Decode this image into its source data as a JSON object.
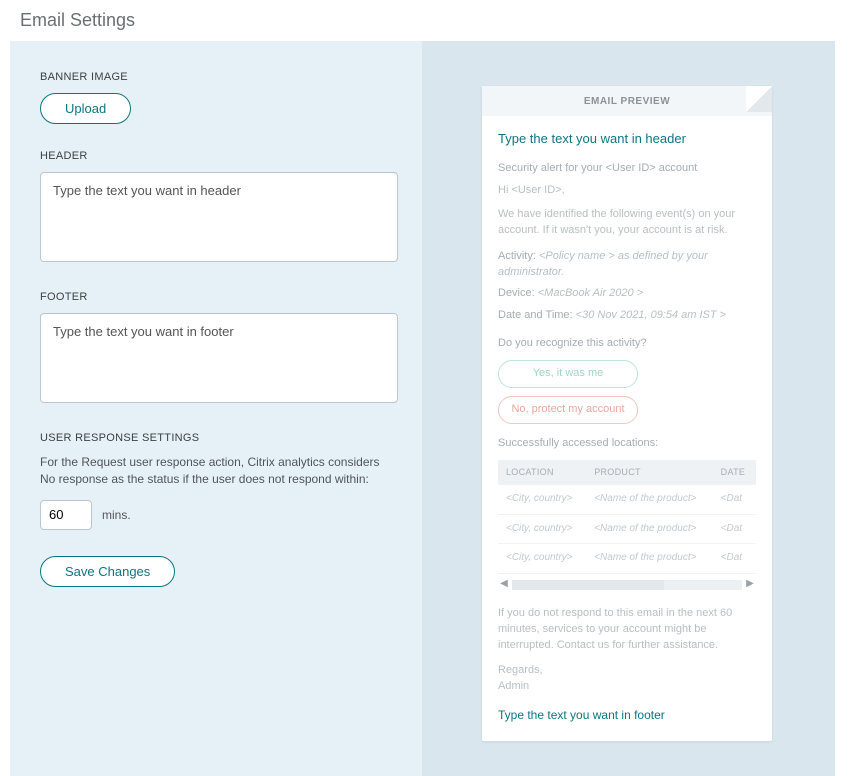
{
  "page": {
    "title": "Email Settings"
  },
  "banner": {
    "label": "BANNER IMAGE",
    "upload_label": "Upload"
  },
  "header": {
    "label": "HEADER",
    "placeholder": "Type the text you want in header"
  },
  "footer": {
    "label": "FOOTER",
    "placeholder": "Type the text you want in footer"
  },
  "response": {
    "label": "USER RESPONSE SETTINGS",
    "description": "For the Request user response action, Citrix analytics considers No response as the status if the user does not respond within:",
    "value": "60",
    "unit": "mins."
  },
  "save": {
    "label": "Save Changes"
  },
  "preview": {
    "title": "EMAIL PREVIEW",
    "header_text": "Type the text you want in header",
    "subject": "Security alert for your <User ID> account",
    "greeting": "Hi <User ID>,",
    "intro": "We have identified the following event(s) on your account. If it wasn't you, your account is at risk.",
    "activity_label": "Activity:",
    "activity_value": "<Policy name > as defined by your administrator.",
    "device_label": "Device:",
    "device_value": "<MacBook Air 2020 >",
    "datetime_label": "Date and Time:",
    "datetime_value": "<30 Nov 2021, 09:54 am IST >",
    "recognize": "Do you recognize this activity?",
    "yes_label": "Yes, it was me",
    "no_label": "No, protect my account",
    "locations_label": "Successfully accessed locations:",
    "table": {
      "cols": [
        "LOCATION",
        "PRODUCT",
        "DATE"
      ],
      "rows": [
        [
          "<City, country>",
          "<Name of the product>",
          "<Dat"
        ],
        [
          "<City, country>",
          "<Name of the product>",
          "<Dat"
        ],
        [
          "<City, country>",
          "<Name of the product>",
          "<Dat"
        ]
      ]
    },
    "no_respond": "If you do not respond to this email in the next 60 minutes, services to your account might be interrupted. Contact us for further assistance.",
    "regards": "Regards,",
    "admin": "Admin",
    "footer_text": "Type the text you want in footer"
  }
}
